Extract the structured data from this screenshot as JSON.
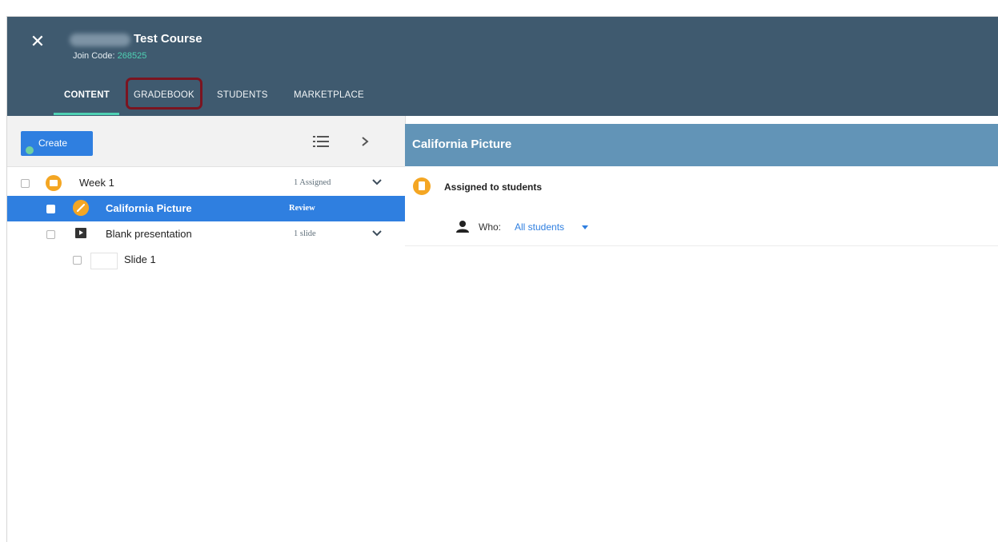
{
  "header": {
    "close_icon": "close-icon",
    "course_title": "Test Course",
    "join_code_label": "Join Code:",
    "join_code_value": "268525",
    "tabs": [
      {
        "label": "CONTENT",
        "active": true
      },
      {
        "label": "GRADEBOOK",
        "active": false,
        "highlighted": true
      },
      {
        "label": "STUDENTS",
        "active": false
      },
      {
        "label": "MARKETPLACE",
        "active": false
      }
    ]
  },
  "content_panel": {
    "create_label": "Create",
    "list_view_icon": "list-icon",
    "expand_icon": "chevron-right-icon",
    "items": [
      {
        "label": "Week 1",
        "meta": "1 Assigned",
        "icon": "folder-icon",
        "selected": false
      },
      {
        "label": "California Picture",
        "meta": "Review",
        "icon": "pencil-icon",
        "selected": true
      },
      {
        "label": "Blank presentation",
        "meta": "1 slide",
        "icon": "presentation-icon",
        "selected": false
      },
      {
        "label": "Slide 1",
        "meta": "",
        "icon": "slide-thumbnail",
        "selected": false
      }
    ]
  },
  "detail_panel": {
    "title": "California Picture",
    "status_label": "Assigned to students",
    "who_label": "Who:",
    "who_value": "All students"
  },
  "colors": {
    "header_bg": "#3f5a6f",
    "accent_teal": "#4fd1b3",
    "selection_blue": "#2f7fe0",
    "detail_header_bg": "#6294b7",
    "icon_orange": "#f4a623",
    "highlight_box": "#7b1420"
  }
}
